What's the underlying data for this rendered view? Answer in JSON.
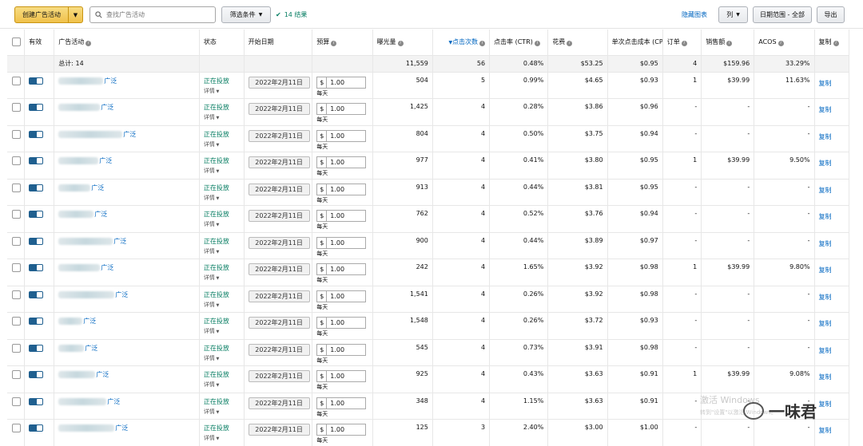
{
  "toolbar": {
    "create_label": "创建广告活动",
    "search_placeholder": "查找广告活动",
    "filter_label": "筛选条件",
    "result_text": "14 结果",
    "hide_chart_label": "隐藏图表",
    "columns_label": "列",
    "date_range_label": "日期范围 - 全部",
    "export_label": "导出"
  },
  "headers": {
    "active": "有效",
    "campaign": "广告活动",
    "status": "状态",
    "start_date": "开始日期",
    "budget": "预算",
    "impressions": "曝光量",
    "clicks": "点击次数",
    "ctr": "点击率 (CTR)",
    "spend": "花费",
    "cpc": "单次点击成本 (CPC)",
    "orders": "订单",
    "sales": "销售额",
    "acos": "ACOS",
    "copy": "复制"
  },
  "totals": {
    "label": "总计: 14",
    "impressions": "11,559",
    "clicks": "56",
    "ctr": "0.48%",
    "spend": "$53.25",
    "cpc": "$0.95",
    "orders": "4",
    "sales": "$159.96",
    "acos": "33.29%"
  },
  "row_common": {
    "status": "正在投放",
    "details": "详情",
    "start_date": "2022年2月11日",
    "currency": "$",
    "budget": "1.00",
    "budget_unit": "每天",
    "copy": "复制",
    "campaign_suffix": "广泛"
  },
  "rows": [
    {
      "impressions": "504",
      "clicks": "5",
      "ctr": "0.99%",
      "spend": "$4.65",
      "cpc": "$0.93",
      "orders": "1",
      "sales": "$39.99",
      "acos": "11.63%"
    },
    {
      "impressions": "1,425",
      "clicks": "4",
      "ctr": "0.28%",
      "spend": "$3.86",
      "cpc": "$0.96",
      "orders": "-",
      "sales": "-",
      "acos": "-"
    },
    {
      "impressions": "804",
      "clicks": "4",
      "ctr": "0.50%",
      "spend": "$3.75",
      "cpc": "$0.94",
      "orders": "-",
      "sales": "-",
      "acos": "-"
    },
    {
      "impressions": "977",
      "clicks": "4",
      "ctr": "0.41%",
      "spend": "$3.80",
      "cpc": "$0.95",
      "orders": "1",
      "sales": "$39.99",
      "acos": "9.50%"
    },
    {
      "impressions": "913",
      "clicks": "4",
      "ctr": "0.44%",
      "spend": "$3.81",
      "cpc": "$0.95",
      "orders": "-",
      "sales": "-",
      "acos": "-"
    },
    {
      "impressions": "762",
      "clicks": "4",
      "ctr": "0.52%",
      "spend": "$3.76",
      "cpc": "$0.94",
      "orders": "-",
      "sales": "-",
      "acos": "-"
    },
    {
      "impressions": "900",
      "clicks": "4",
      "ctr": "0.44%",
      "spend": "$3.89",
      "cpc": "$0.97",
      "orders": "-",
      "sales": "-",
      "acos": "-"
    },
    {
      "impressions": "242",
      "clicks": "4",
      "ctr": "1.65%",
      "spend": "$3.92",
      "cpc": "$0.98",
      "orders": "1",
      "sales": "$39.99",
      "acos": "9.80%"
    },
    {
      "impressions": "1,541",
      "clicks": "4",
      "ctr": "0.26%",
      "spend": "$3.92",
      "cpc": "$0.98",
      "orders": "-",
      "sales": "-",
      "acos": "-"
    },
    {
      "impressions": "1,548",
      "clicks": "4",
      "ctr": "0.26%",
      "spend": "$3.72",
      "cpc": "$0.93",
      "orders": "-",
      "sales": "-",
      "acos": "-"
    },
    {
      "impressions": "545",
      "clicks": "4",
      "ctr": "0.73%",
      "spend": "$3.91",
      "cpc": "$0.98",
      "orders": "-",
      "sales": "-",
      "acos": "-"
    },
    {
      "impressions": "925",
      "clicks": "4",
      "ctr": "0.43%",
      "spend": "$3.63",
      "cpc": "$0.91",
      "orders": "1",
      "sales": "$39.99",
      "acos": "9.08%"
    },
    {
      "impressions": "348",
      "clicks": "4",
      "ctr": "1.15%",
      "spend": "$3.63",
      "cpc": "$0.91",
      "orders": "-",
      "sales": "-",
      "acos": "-"
    },
    {
      "impressions": "125",
      "clicks": "3",
      "ctr": "2.40%",
      "spend": "$3.00",
      "cpc": "$1.00",
      "orders": "-",
      "sales": "-",
      "acos": "-"
    }
  ],
  "watermark": {
    "line1": "激活 Windows",
    "line2": "转到\"设置\"以激活 Windows。",
    "brand": "一味君"
  },
  "colors": {
    "accent_link": "#0066c0",
    "status_green": "#067d62",
    "create_button": "#f0c14b",
    "toggle_on": "#1f5f8f"
  }
}
